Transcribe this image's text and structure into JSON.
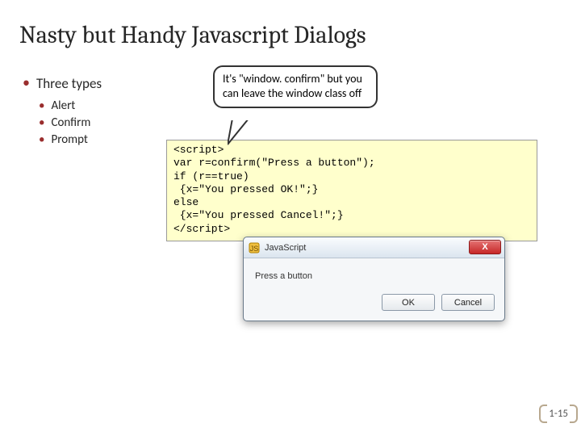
{
  "title": "Nasty but Handy Javascript Dialogs",
  "bullets": {
    "l1": "Three types",
    "l2": [
      "Alert",
      "Confirm",
      "Prompt"
    ]
  },
  "callout": "It's \"window. confirm\" but you can leave the window class off",
  "code": "<script>\nvar r=confirm(\"Press a button\");\nif (r==true)\n {x=\"You pressed OK!\";}\nelse\n {x=\"You pressed Cancel!\";}\n</script>",
  "dialog": {
    "title": "JavaScript",
    "message": "Press a button",
    "ok": "OK",
    "cancel": "Cancel",
    "close": "X"
  },
  "pageNumber": "1-15"
}
